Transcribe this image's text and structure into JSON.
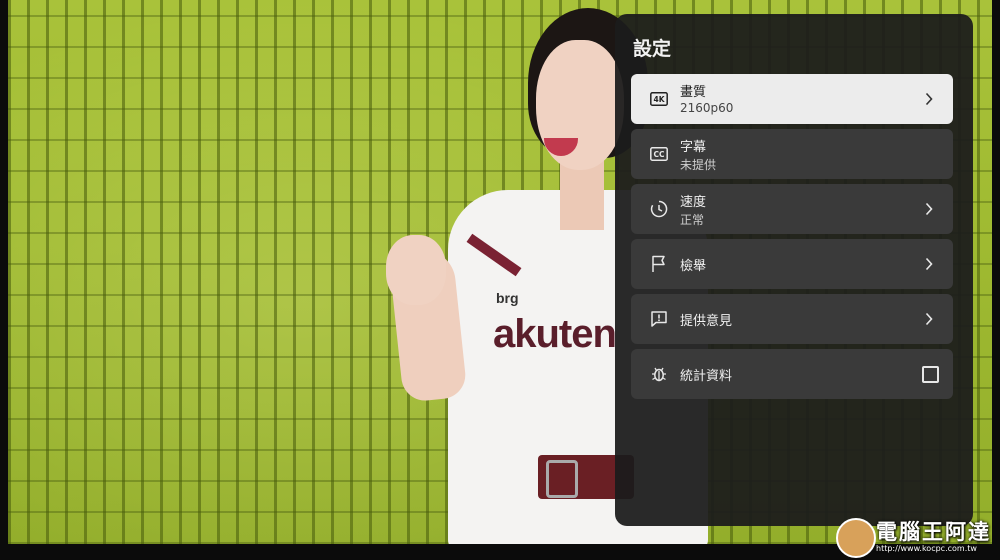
{
  "video": {
    "jersey_brand": "akuten",
    "jersey_sponsor": "brg"
  },
  "settings": {
    "title": "設定",
    "items": [
      {
        "label": "畫質",
        "sub": "2160p60",
        "icon": "4k-icon",
        "icon_text": "4K",
        "control": "chevron",
        "selected": true
      },
      {
        "label": "字幕",
        "sub": "未提供",
        "icon": "cc-icon",
        "icon_text": "CC",
        "control": "none",
        "selected": false
      },
      {
        "label": "速度",
        "sub": "正常",
        "icon": "speed-icon",
        "control": "chevron",
        "selected": false
      },
      {
        "label": "檢舉",
        "sub": "",
        "icon": "flag-icon",
        "control": "chevron",
        "selected": false
      },
      {
        "label": "提供意見",
        "sub": "",
        "icon": "feedback-icon",
        "control": "chevron",
        "selected": false
      },
      {
        "label": "統計資料",
        "sub": "",
        "icon": "bug-icon",
        "control": "checkbox",
        "checked": false,
        "selected": false
      }
    ]
  },
  "watermark": {
    "title": "電腦王阿達",
    "url": "http://www.kocpc.com.tw"
  },
  "colors": {
    "panel_bg": "#1c1c1c",
    "item_bg": "#3a3a3a",
    "selected_bg": "#ececec"
  }
}
